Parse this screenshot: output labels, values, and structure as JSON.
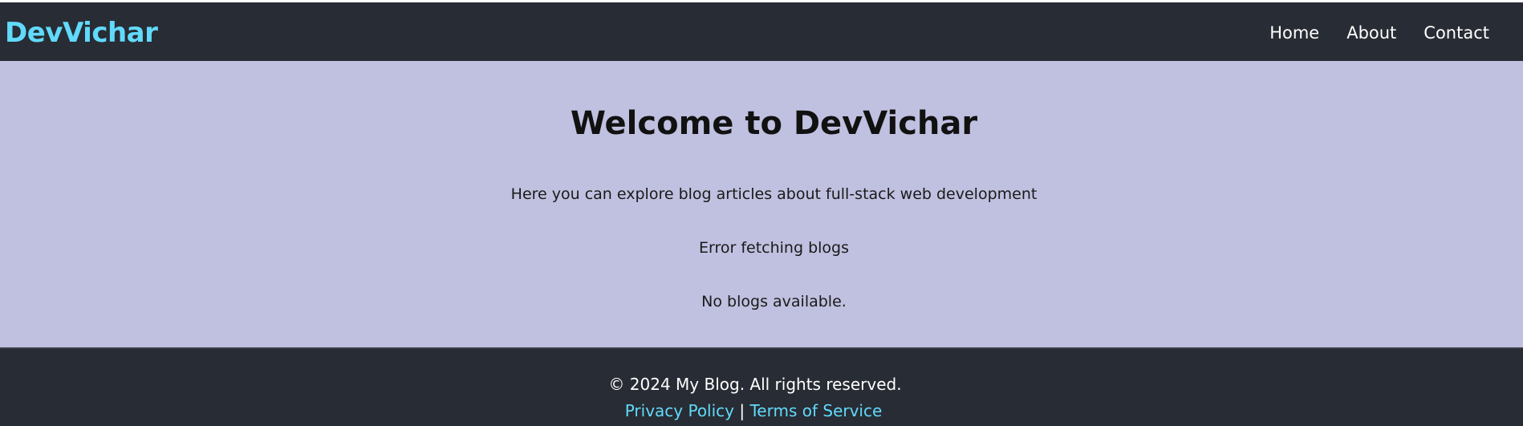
{
  "header": {
    "brand": "DevVichar",
    "nav": [
      {
        "label": "Home"
      },
      {
        "label": "About"
      },
      {
        "label": "Contact"
      }
    ]
  },
  "main": {
    "title": "Welcome to DevVichar",
    "intro": "Here you can explore blog articles about full-stack web development",
    "error": "Error fetching blogs",
    "empty": "No blogs available."
  },
  "footer": {
    "copyright": "© 2024 My Blog. All rights reserved.",
    "privacy": "Privacy Policy",
    "separator": "|",
    "terms": "Terms of Service"
  },
  "colors": {
    "header_bg": "#282c34",
    "accent": "#61dafb",
    "main_bg": "#c0c0e0",
    "footer_bg": "#282c34"
  }
}
